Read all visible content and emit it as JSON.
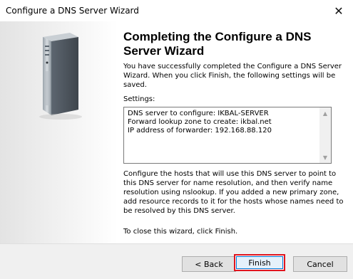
{
  "window": {
    "title": "Configure a DNS Server Wizard",
    "close_glyph": "✕"
  },
  "wizard": {
    "heading": "Completing the Configure a DNS Server Wizard",
    "intro": "You have successfully completed the Configure a DNS Server Wizard. When you click Finish, the following settings will be saved.",
    "settings_label": "Settings:",
    "settings": [
      "DNS server to configure: IKBAL-SERVER",
      "Forward lookup zone to create: ikbal.net",
      "IP address of forwarder: 192.168.88.120"
    ],
    "note": "Configure the hosts that will use this DNS server to point to this DNS server for name resolution, and then verify name resolution using nslookup. If you added a new primary zone, add resource records to it for the hosts whose names need to be resolved by this DNS server.",
    "close_instruction": "To close this wizard, click Finish."
  },
  "buttons": {
    "back": "< Back",
    "finish": "Finish",
    "cancel": "Cancel"
  },
  "icons": {
    "server": "server-tower-icon",
    "close": "close-icon",
    "scroll_up": "chevron-up-icon",
    "scroll_down": "chevron-down-icon"
  },
  "colors": {
    "highlight": "#e0151f",
    "focus": "#0078d7"
  }
}
